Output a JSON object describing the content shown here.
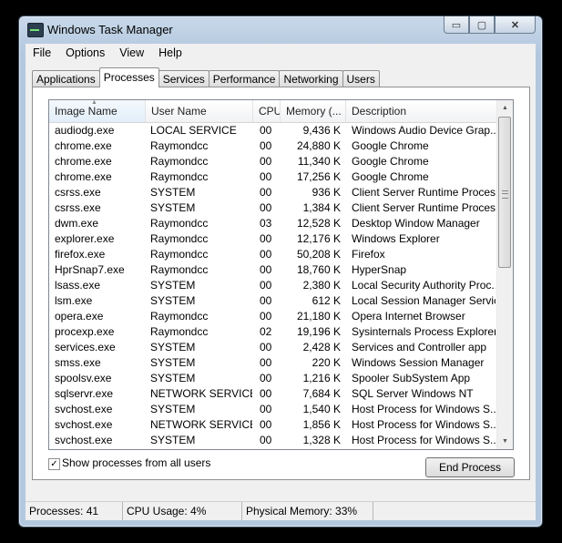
{
  "window": {
    "title": "Windows Task Manager",
    "minimize_glyph": "▭",
    "maximize_glyph": "▢",
    "close_glyph": "✕"
  },
  "menu": [
    "File",
    "Options",
    "View",
    "Help"
  ],
  "tabs": [
    "Applications",
    "Processes",
    "Services",
    "Performance",
    "Networking",
    "Users"
  ],
  "active_tab": "Processes",
  "table": {
    "columns": [
      "Image Name",
      "User Name",
      "CPU",
      "Memory (...",
      "Description"
    ],
    "rows": [
      [
        "audiodg.exe",
        "LOCAL SERVICE",
        "00",
        "9,436 K",
        "Windows Audio Device Grap..."
      ],
      [
        "chrome.exe",
        "Raymondcc",
        "00",
        "24,880 K",
        "Google Chrome"
      ],
      [
        "chrome.exe",
        "Raymondcc",
        "00",
        "11,340 K",
        "Google Chrome"
      ],
      [
        "chrome.exe",
        "Raymondcc",
        "00",
        "17,256 K",
        "Google Chrome"
      ],
      [
        "csrss.exe",
        "SYSTEM",
        "00",
        "936 K",
        "Client Server Runtime Process"
      ],
      [
        "csrss.exe",
        "SYSTEM",
        "00",
        "1,384 K",
        "Client Server Runtime Process"
      ],
      [
        "dwm.exe",
        "Raymondcc",
        "03",
        "12,528 K",
        "Desktop Window Manager"
      ],
      [
        "explorer.exe",
        "Raymondcc",
        "00",
        "12,176 K",
        "Windows Explorer"
      ],
      [
        "firefox.exe",
        "Raymondcc",
        "00",
        "50,208 K",
        "Firefox"
      ],
      [
        "HprSnap7.exe",
        "Raymondcc",
        "00",
        "18,760 K",
        "HyperSnap"
      ],
      [
        "lsass.exe",
        "SYSTEM",
        "00",
        "2,380 K",
        "Local Security Authority Proc..."
      ],
      [
        "lsm.exe",
        "SYSTEM",
        "00",
        "612 K",
        "Local Session Manager Service"
      ],
      [
        "opera.exe",
        "Raymondcc",
        "00",
        "21,180 K",
        "Opera Internet Browser"
      ],
      [
        "procexp.exe",
        "Raymondcc",
        "02",
        "19,196 K",
        "Sysinternals Process Explorer"
      ],
      [
        "services.exe",
        "SYSTEM",
        "00",
        "2,428 K",
        "Services and Controller app"
      ],
      [
        "smss.exe",
        "SYSTEM",
        "00",
        "220 K",
        "Windows Session Manager"
      ],
      [
        "spoolsv.exe",
        "SYSTEM",
        "00",
        "1,216 K",
        "Spooler SubSystem App"
      ],
      [
        "sqlservr.exe",
        "NETWORK SERVICE",
        "00",
        "7,684 K",
        "SQL Server Windows NT"
      ],
      [
        "svchost.exe",
        "SYSTEM",
        "00",
        "1,540 K",
        "Host Process for Windows S..."
      ],
      [
        "svchost.exe",
        "NETWORK SERVICE",
        "00",
        "1,856 K",
        "Host Process for Windows S..."
      ],
      [
        "svchost.exe",
        "SYSTEM",
        "00",
        "1,328 K",
        "Host Process for Windows S..."
      ]
    ]
  },
  "show_all": {
    "label": "Show processes from all users",
    "checked": true,
    "check_glyph": "✓"
  },
  "end_process_label": "End Process",
  "scroll_arrows": {
    "up": "▲",
    "down": "▼"
  },
  "status": {
    "processes": "Processes: 41",
    "cpu": "CPU Usage: 4%",
    "memory": "Physical Memory: 33%"
  }
}
